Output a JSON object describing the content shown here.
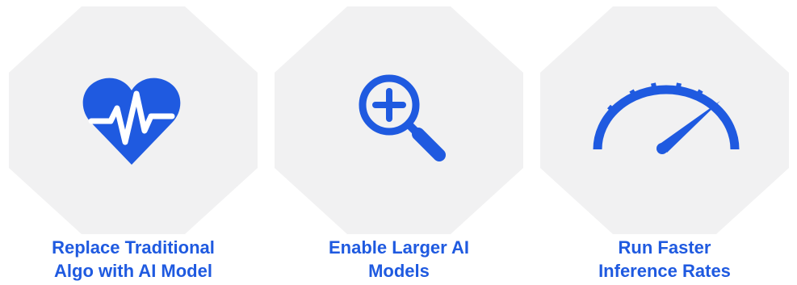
{
  "colors": {
    "accent": "#1f5ae0",
    "tile_background": "#f1f1f2",
    "page_background": "#ffffff"
  },
  "features": [
    {
      "icon": "heart-pulse-icon",
      "label_lines": [
        "Replace Traditional",
        "Algo with AI Model"
      ]
    },
    {
      "icon": "zoom-in-icon",
      "label_lines": [
        "Enable Larger AI",
        "Models"
      ]
    },
    {
      "icon": "speedometer-icon",
      "label_lines": [
        "Run Faster",
        "Inference Rates"
      ]
    }
  ]
}
